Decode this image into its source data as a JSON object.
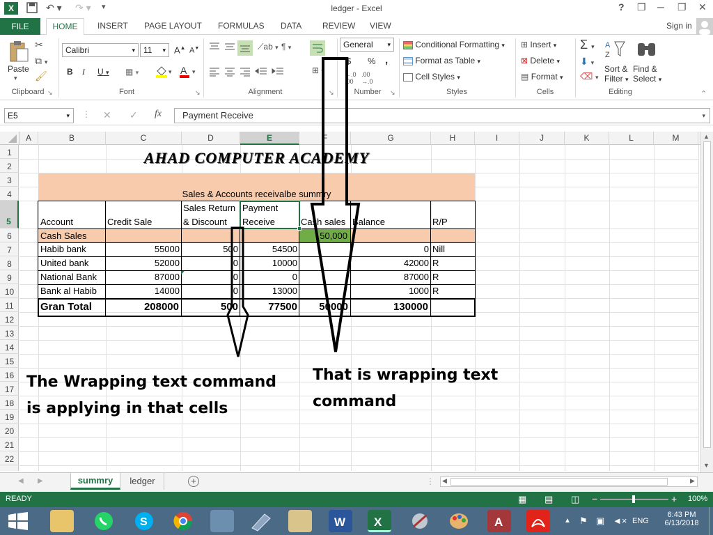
{
  "window": {
    "title": "ledger - Excel",
    "controls": [
      "?",
      "❐",
      "─",
      "❐",
      "✕"
    ]
  },
  "ribbon_tabs": {
    "file": "FILE",
    "home": "HOME",
    "insert": "INSERT",
    "page_layout": "PAGE LAYOUT",
    "formulas": "FORMULAS",
    "data": "DATA",
    "review": "REVIEW",
    "view": "VIEW",
    "sign_in": "Sign in"
  },
  "ribbon": {
    "clipboard": {
      "paste": "Paste",
      "label": "Clipboard"
    },
    "font": {
      "name": "Calibri",
      "size": "11",
      "bold": "B",
      "italic": "I",
      "underline": "U",
      "grow": "A",
      "shrink": "A",
      "label": "Font"
    },
    "alignment": {
      "label": "Alignment"
    },
    "number": {
      "format": "General",
      "currency": "$",
      "percent": "%",
      "comma": ",",
      "label": "Number"
    },
    "styles": {
      "conditional": "Conditional Formatting",
      "format_table": "Format as Table",
      "cell_styles": "Cell Styles",
      "label": "Styles"
    },
    "cells": {
      "insert": "Insert",
      "delete": "Delete",
      "format": "Format",
      "label": "Cells"
    },
    "editing": {
      "sort1": "Sort &",
      "sort2": "Filter",
      "find1": "Find &",
      "find2": "Select",
      "label": "Editing"
    }
  },
  "formula_bar": {
    "name_box": "E5",
    "fx": "fx",
    "content": "Payment Receive"
  },
  "columns": [
    "A",
    "B",
    "C",
    "D",
    "E",
    "F",
    "G",
    "H",
    "I",
    "J",
    "K",
    "L",
    "M"
  ],
  "rows": [
    "1",
    "2",
    "3",
    "4",
    "5",
    "6",
    "7",
    "8",
    "9",
    "10",
    "11",
    "12",
    "13",
    "14",
    "15",
    "16",
    "17",
    "18",
    "19",
    "20",
    "21",
    "22"
  ],
  "sheet": {
    "title": "AHAD COMPUTER ACADEMY",
    "subtitle": "Sales & Accounts receivalbe summry",
    "headers": {
      "account": "Account",
      "credit_sale": "Credit Sale",
      "sales_return_1": "Sales Return",
      "sales_return_2": "& Discount",
      "payment_1": "Payment",
      "payment_2": "Receive",
      "cash_sales": "Cash sales",
      "balance": "Balance",
      "rp": "R/P"
    },
    "cash_row": {
      "account": "Cash Sales",
      "cash_sales": "50,000"
    },
    "rows": [
      {
        "account": "Habib bank",
        "credit": "55000",
        "ret": "500",
        "pay": "54500",
        "cash": "",
        "balance": "0",
        "rp": "Nill"
      },
      {
        "account": "United bank",
        "credit": "52000",
        "ret": "0",
        "pay": "10000",
        "cash": "",
        "balance": "42000",
        "rp": "R"
      },
      {
        "account": "National Bank",
        "credit": "87000",
        "ret": "0",
        "pay": "0",
        "cash": "",
        "balance": "87000",
        "rp": "R"
      },
      {
        "account": "Bank al Habib",
        "credit": "14000",
        "ret": "0",
        "pay": "13000",
        "cash": "",
        "balance": "1000",
        "rp": "R"
      }
    ],
    "total": {
      "label": "Gran Total",
      "credit": "208000",
      "ret": "500",
      "pay": "77500",
      "cash": "50000",
      "balance": "130000"
    },
    "annotation_left_1": "The Wrapping text command",
    "annotation_left_2": "is applying in that cells",
    "annotation_right_1": "That is wrapping text",
    "annotation_right_2": "command"
  },
  "sheet_tabs": {
    "active": "summry",
    "other": "ledger"
  },
  "status": {
    "ready": "READY",
    "zoom": "100%"
  },
  "taskbar": {
    "lang": "ENG",
    "time": "6:43 PM",
    "date": "6/13/2018"
  },
  "colors": {
    "excel_green": "#217346",
    "peach": "#f8cbad",
    "cash_green": "#70ad47"
  }
}
